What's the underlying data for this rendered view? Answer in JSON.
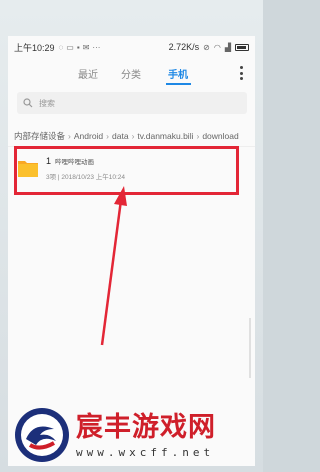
{
  "statusbar": {
    "time": "上午10:29",
    "speed": "2.72K/s"
  },
  "tabs": [
    {
      "label": "最近"
    },
    {
      "label": "分类"
    },
    {
      "label": "手机"
    }
  ],
  "search": {
    "placeholder": "搜索"
  },
  "breadcrumb": {
    "items": [
      "内部存储设备",
      "Android",
      "data",
      "tv.danmaku.bili",
      "download"
    ]
  },
  "file": {
    "name": "1",
    "subtitle": "哔哩哔哩动画",
    "meta": "3项 | 2018/10/23 上午10:24"
  },
  "colors": {
    "accent": "#1e88e5",
    "highlight": "#e32636",
    "folder": "#f9a825"
  },
  "watermark": {
    "title": "宸丰游戏网",
    "url": "www.wxcff.net"
  }
}
